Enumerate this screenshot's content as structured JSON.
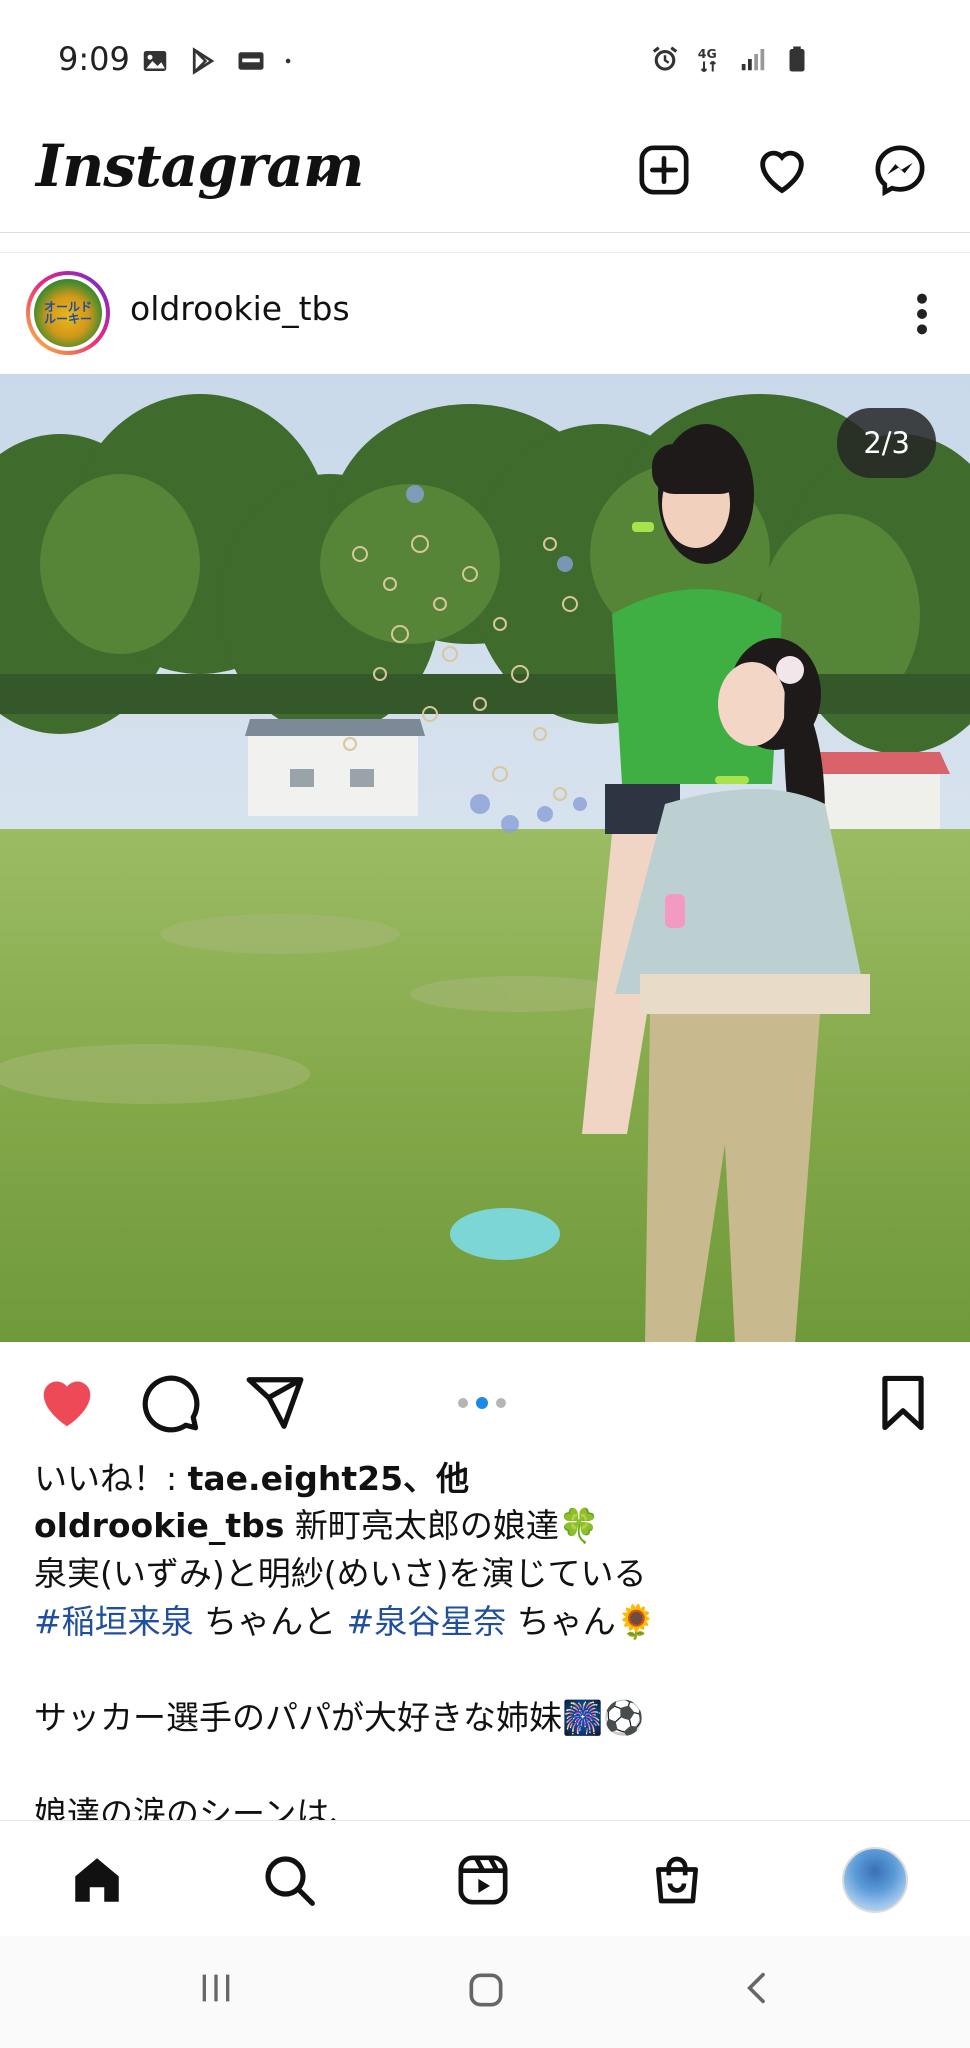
{
  "status_bar": {
    "time": "9:09",
    "left_icons": [
      "image-icon",
      "play-store-icon",
      "news-icon",
      "dot-icon"
    ],
    "right_icons": [
      "alarm-icon",
      "4g-icon",
      "signal-icon",
      "battery-icon"
    ],
    "network": "4G"
  },
  "header": {
    "logo": "Instagram",
    "actions": [
      "create-post-icon",
      "heart-icon",
      "messenger-icon"
    ]
  },
  "post": {
    "username": "oldrookie_tbs",
    "avatar_text": "オールドルーキー",
    "carousel_counter": "2/3",
    "carousel_index": 2,
    "carousel_total": 3,
    "liked": true,
    "likes_prefix": "いいね！: ",
    "likes_user": "tae.eight25",
    "likes_suffix": "、他",
    "caption_user": "oldrookie_tbs",
    "caption_line1": " 新町亮太郎の娘達🍀",
    "caption_line2": "泉実(いずみ)と明紗(めいさ)を演じている",
    "tag1": "#稲垣来泉",
    "tag_mid": " ちゃんと ",
    "tag2": "#泉谷星奈",
    "tag_end": " ちゃん🌻",
    "caption_line4": "サッカー選手のパパが大好きな姉妹🎆⚽",
    "caption_line5": "娘達の涙のシーンは、"
  },
  "bottom_nav": [
    "home-icon",
    "search-icon",
    "reels-icon",
    "shop-icon",
    "profile-avatar"
  ],
  "colors": {
    "like_red": "#ed4956",
    "link_blue": "#1f4f9e",
    "active_dot": "#1e88e5"
  }
}
